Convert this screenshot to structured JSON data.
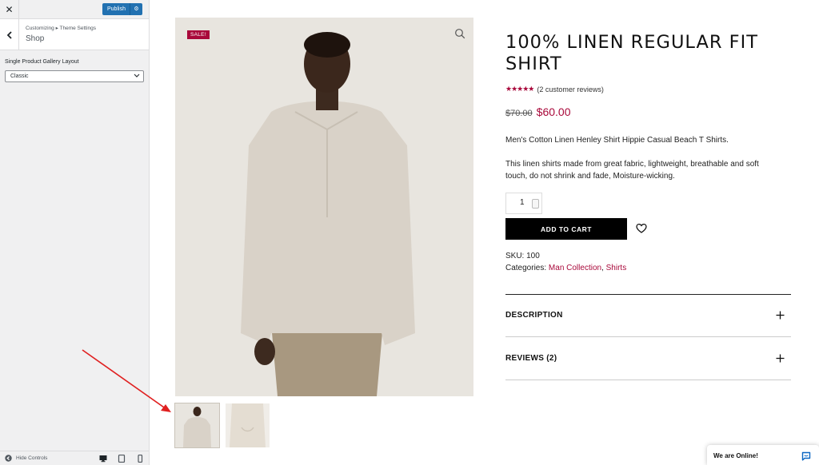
{
  "customizer": {
    "close_icon": "close-icon",
    "publish_label": "Publish",
    "settings_icon": "gear-icon",
    "breadcrumb": "Customizing ▸ Theme Settings",
    "section_title": "Shop",
    "control_label": "Single Product Gallery Layout",
    "layout_value": "Classic",
    "hide_controls_label": "Hide Controls",
    "accent_color": "#2271b1"
  },
  "product": {
    "sale_badge": "SALE!",
    "title": "100% LINEN REGULAR FIT SHIRT",
    "rating": 4.5,
    "stars": "★★★★★",
    "reviews_text": "(2 customer reviews)",
    "price_old": "$70.00",
    "price_new": "$60.00",
    "short_desc": "Men's Cotton Linen Henley Shirt Hippie Casual Beach T Shirts.",
    "long_desc": "This linen shirts made from great fabric, lightweight, breathable and soft touch, do not shrink and fade, Moisture-wicking.",
    "quantity": "1",
    "add_to_cart_label": "ADD TO CART",
    "sku_label": "SKU:",
    "sku_value": "100",
    "categories_label": "Categories:",
    "category_1": "Man Collection",
    "category_2": "Shirts",
    "accent_color": "#a9093b"
  },
  "tabs": {
    "description_label": "DESCRIPTION",
    "reviews_label": "REVIEWS (2)"
  },
  "chat": {
    "label": "We are Online!"
  }
}
